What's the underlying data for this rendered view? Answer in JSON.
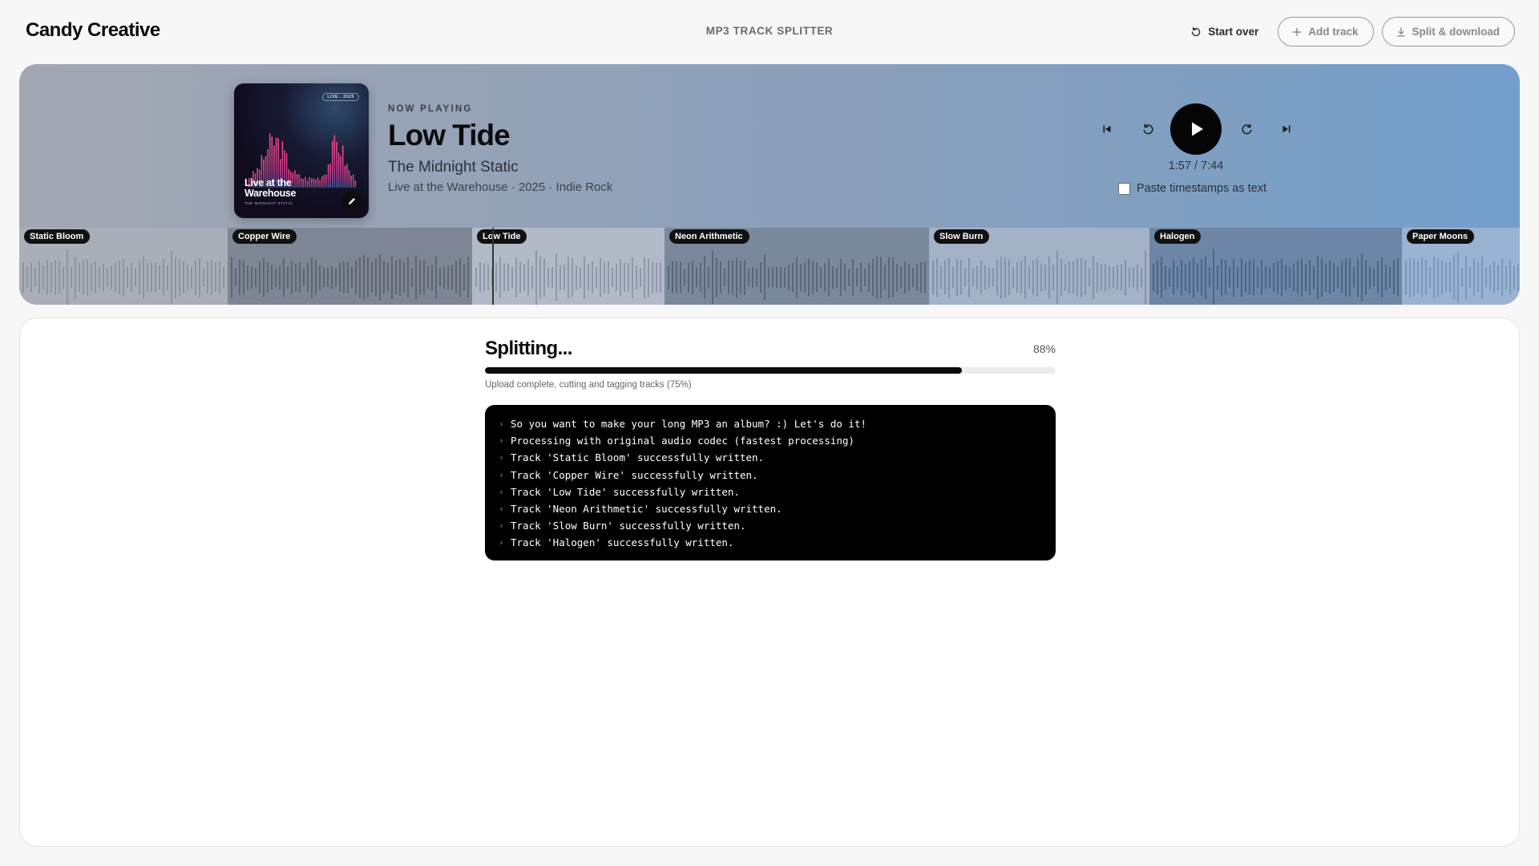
{
  "header": {
    "brand": "Candy Creative",
    "title": "MP3 TRACK SPLITTER",
    "start_over": "Start over",
    "add_track": "Add track",
    "split_download": "Split & download"
  },
  "player": {
    "now_playing_label": "NOW PLAYING",
    "title": "Low Tide",
    "artist": "The Midnight Static",
    "meta": "Live at the Warehouse · 2025 · Indie Rock",
    "cover": {
      "tag": "LIVE · 2025",
      "title": "Live at the Warehouse",
      "subtitle": "THE MIDNIGHT STATIC"
    },
    "current_time": "1:57",
    "total_time": "7:44",
    "time_separator": " / ",
    "paste_timestamps_label": "Paste timestamps as text",
    "paste_timestamps_checked": false
  },
  "tracks": [
    {
      "name": "Static Bloom",
      "shade": "#a9aeb8",
      "bar": "#8e939e"
    },
    {
      "name": "Copper Wire",
      "shade": "#7e8695",
      "bar": "#5f6573"
    },
    {
      "name": "Low Tide",
      "shade": "#b2bac8",
      "bar": "#8f98a8"
    },
    {
      "name": "Neon Arithmetic",
      "shade": "#7a889e",
      "bar": "#5c6678"
    },
    {
      "name": "Slow Burn",
      "shade": "#a3b2c7",
      "bar": "#8393a9"
    },
    {
      "name": "Halogen",
      "shade": "#6d86a6",
      "bar": "#4e6483"
    },
    {
      "name": "Paper Moons",
      "shade": "#9ab3d2",
      "bar": "#7d96b5"
    }
  ],
  "split": {
    "title": "Splitting...",
    "percent_label": "88%",
    "progress": 0.835,
    "status": "Upload complete, cutting and tagging tracks (75%)",
    "log": [
      "So you want to make your long MP3 an album? :) Let's do it!",
      "Processing with original audio codec (fastest processing)",
      "Track 'Static Bloom' successfully written.",
      "Track 'Copper Wire' successfully written.",
      "Track 'Low Tide' successfully written.",
      "Track 'Neon Arithmetic' successfully written.",
      "Track 'Slow Burn' successfully written.",
      "Track 'Halogen' successfully written."
    ]
  },
  "icons": {
    "start_over": "refresh-icon",
    "add_track": "plus-icon",
    "split_download": "download-icon",
    "prev": "skip-back-icon",
    "rewind": "rewind-icon",
    "play": "play-icon",
    "forward": "forward-icon",
    "next": "skip-forward-icon",
    "edit_cover": "pencil-icon"
  }
}
